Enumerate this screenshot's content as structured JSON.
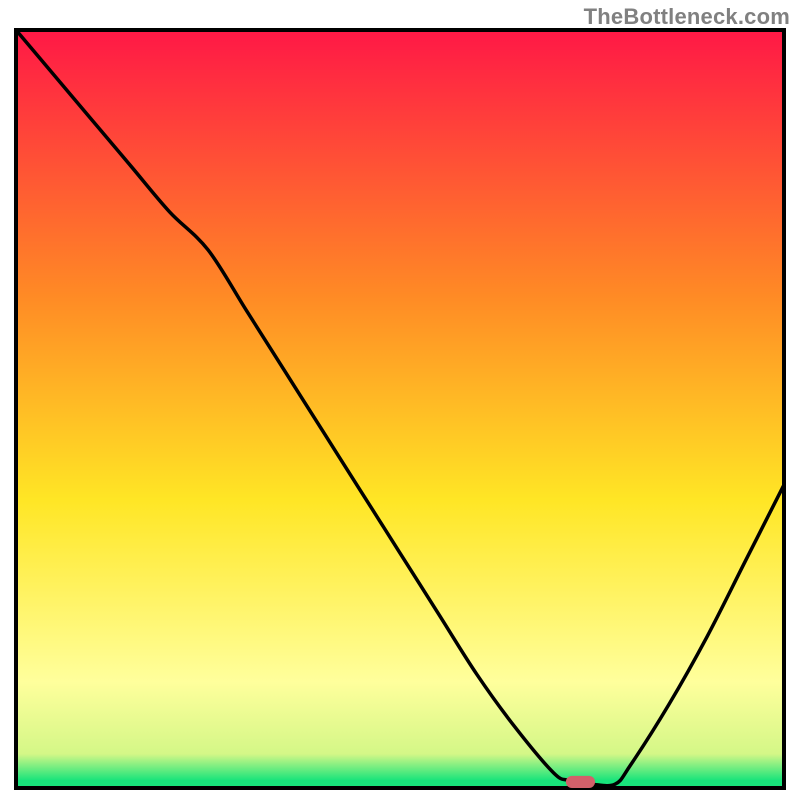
{
  "watermark": "TheBottleneck.com",
  "colors": {
    "black": "#000000",
    "red": "#ff1846",
    "orange": "#ff8a25",
    "yellow": "#ffe625",
    "pale_yellow": "#ffff9c",
    "green": "#18e47b",
    "marker_fill": "#d2606a"
  },
  "chart_data": {
    "type": "line",
    "title": "",
    "xlabel": "",
    "ylabel": "",
    "xlim": [
      0,
      100
    ],
    "ylim": [
      0,
      100
    ],
    "grid": false,
    "legend": false,
    "annotations": [
      "TheBottleneck.com"
    ],
    "series": [
      {
        "name": "curve",
        "x": [
          0,
          5,
          10,
          15,
          20,
          25,
          30,
          35,
          40,
          45,
          50,
          55,
          60,
          65,
          70,
          72,
          75,
          78,
          80,
          85,
          90,
          95,
          100
        ],
        "y": [
          100,
          94,
          88,
          82,
          76,
          71,
          63,
          55,
          47,
          39,
          31,
          23,
          15,
          8,
          2,
          1,
          0.5,
          0.5,
          3,
          11,
          20,
          30,
          40
        ]
      }
    ],
    "marker": {
      "x": 73.5,
      "y": 0.8,
      "w": 3.8,
      "h": 1.6
    },
    "background_gradient": [
      {
        "offset": 0.0,
        "color": "#ff1846"
      },
      {
        "offset": 0.35,
        "color": "#ff8a25"
      },
      {
        "offset": 0.62,
        "color": "#ffe625"
      },
      {
        "offset": 0.86,
        "color": "#ffff9c"
      },
      {
        "offset": 0.955,
        "color": "#d4f787"
      },
      {
        "offset": 0.99,
        "color": "#18e47b"
      }
    ]
  }
}
